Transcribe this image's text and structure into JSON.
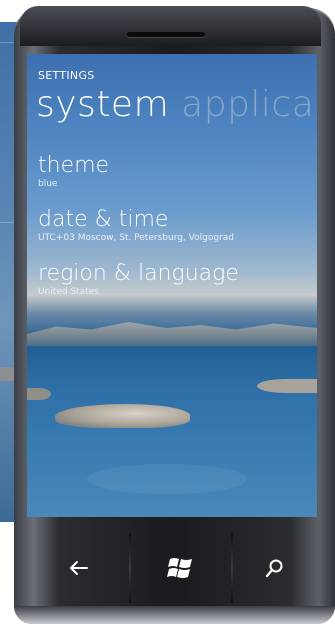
{
  "header": {
    "breadcrumb": "SETTINGS",
    "pivot_active": "system",
    "pivot_next": "applica"
  },
  "items": [
    {
      "title": "theme",
      "subtitle": "blue"
    },
    {
      "title": "date & time",
      "subtitle": "UTC+03 Moscow, St. Petersburg, Volgograd"
    },
    {
      "title": "region & language",
      "subtitle": "United States"
    }
  ],
  "hardware_buttons": [
    {
      "icon": "back-arrow-icon"
    },
    {
      "icon": "windows-logo-icon"
    },
    {
      "icon": "search-icon"
    }
  ],
  "colors": {
    "text": "#ffffff",
    "inactive_pivot": "#bec8d7"
  }
}
